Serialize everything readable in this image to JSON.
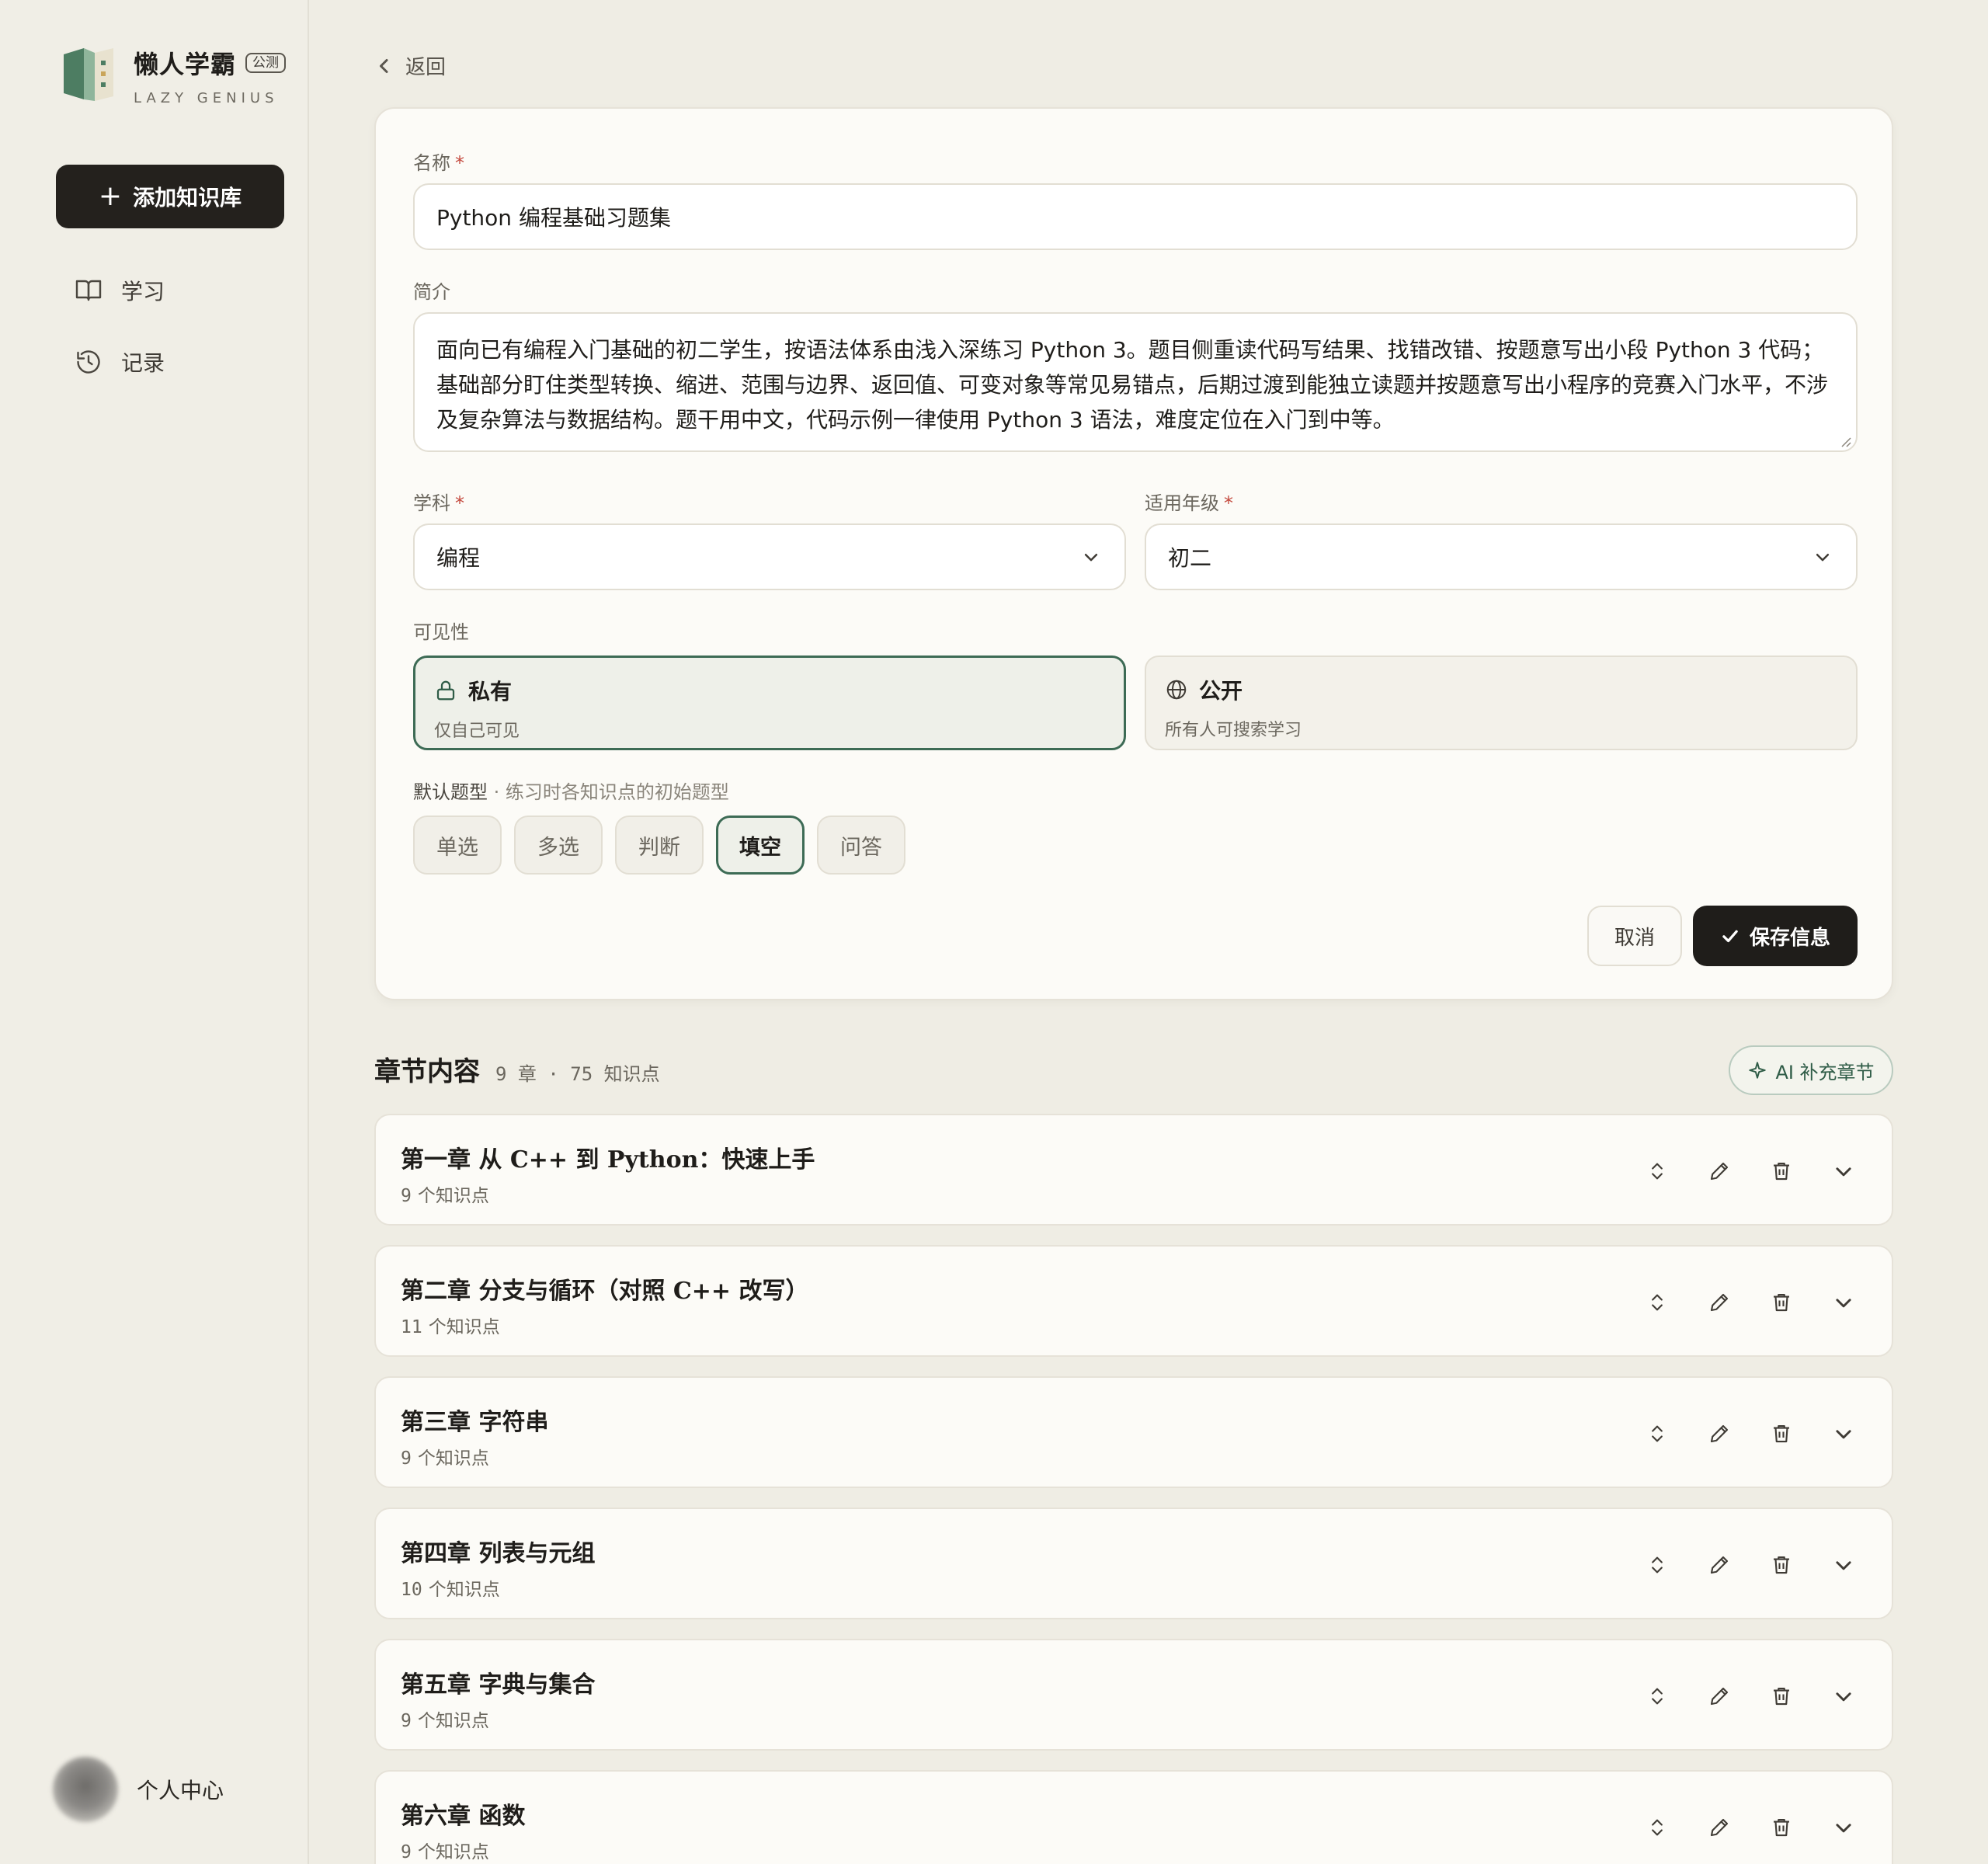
{
  "app": {
    "name": "懒人学霸",
    "badge": "公测",
    "subtitle": "LAZY GENIUS",
    "colors": {
      "brand_green": "#3d6b55",
      "dark": "#1f1d1a",
      "background": "#efede4"
    }
  },
  "sidebar": {
    "add_button": "添加知识库",
    "items": [
      {
        "label": "学习",
        "icon": "book-open-icon"
      },
      {
        "label": "记录",
        "icon": "history-icon"
      }
    ],
    "profile_label": "个人中心"
  },
  "back_label": "返回",
  "form": {
    "name_label": "名称",
    "required_mark": "*",
    "name_value": "Python 编程基础习题集",
    "intro_label": "简介",
    "intro_value": "面向已有编程入门基础的初二学生，按语法体系由浅入深练习 Python 3。题目侧重读代码写结果、找错改错、按题意写出小段 Python 3 代码；基础部分盯住类型转换、缩进、范围与边界、返回值、可变对象等常见易错点，后期过渡到能独立读题并按题意写出小程序的竞赛入门水平，不涉及复杂算法与数据结构。题干用中文，代码示例一律使用 Python 3 语法，难度定位在入门到中等。",
    "subject_label": "学科",
    "subject_value": "编程",
    "grade_label": "适用年级",
    "grade_value": "初二",
    "visibility_label": "可见性",
    "visibility": [
      {
        "title": "私有",
        "desc": "仅自己可见",
        "selected": true,
        "icon": "lock-icon"
      },
      {
        "title": "公开",
        "desc": "所有人可搜索学习",
        "selected": false,
        "icon": "globe-icon"
      }
    ],
    "default_type_label": "默认题型",
    "default_type_hint": " · 练习时各知识点的初始题型",
    "question_types": [
      {
        "label": "单选",
        "selected": false
      },
      {
        "label": "多选",
        "selected": false
      },
      {
        "label": "判断",
        "selected": false
      },
      {
        "label": "填空",
        "selected": true
      },
      {
        "label": "问答",
        "selected": false
      }
    ],
    "cancel_label": "取消",
    "save_label": "保存信息"
  },
  "chapters_section": {
    "title": "章节内容",
    "summary": "9 章 · 75 知识点",
    "ai_button": "AI 补充章节",
    "count_suffix": "个知识点",
    "chapters": [
      {
        "title": "第一章 从 C++ 到 Python：快速上手",
        "count": "9"
      },
      {
        "title": "第二章 分支与循环（对照 C++ 改写）",
        "count": "11"
      },
      {
        "title": "第三章 字符串",
        "count": "9"
      },
      {
        "title": "第四章 列表与元组",
        "count": "10"
      },
      {
        "title": "第五章 字典与集合",
        "count": "9"
      },
      {
        "title": "第六章 函数",
        "count": "9"
      }
    ]
  }
}
